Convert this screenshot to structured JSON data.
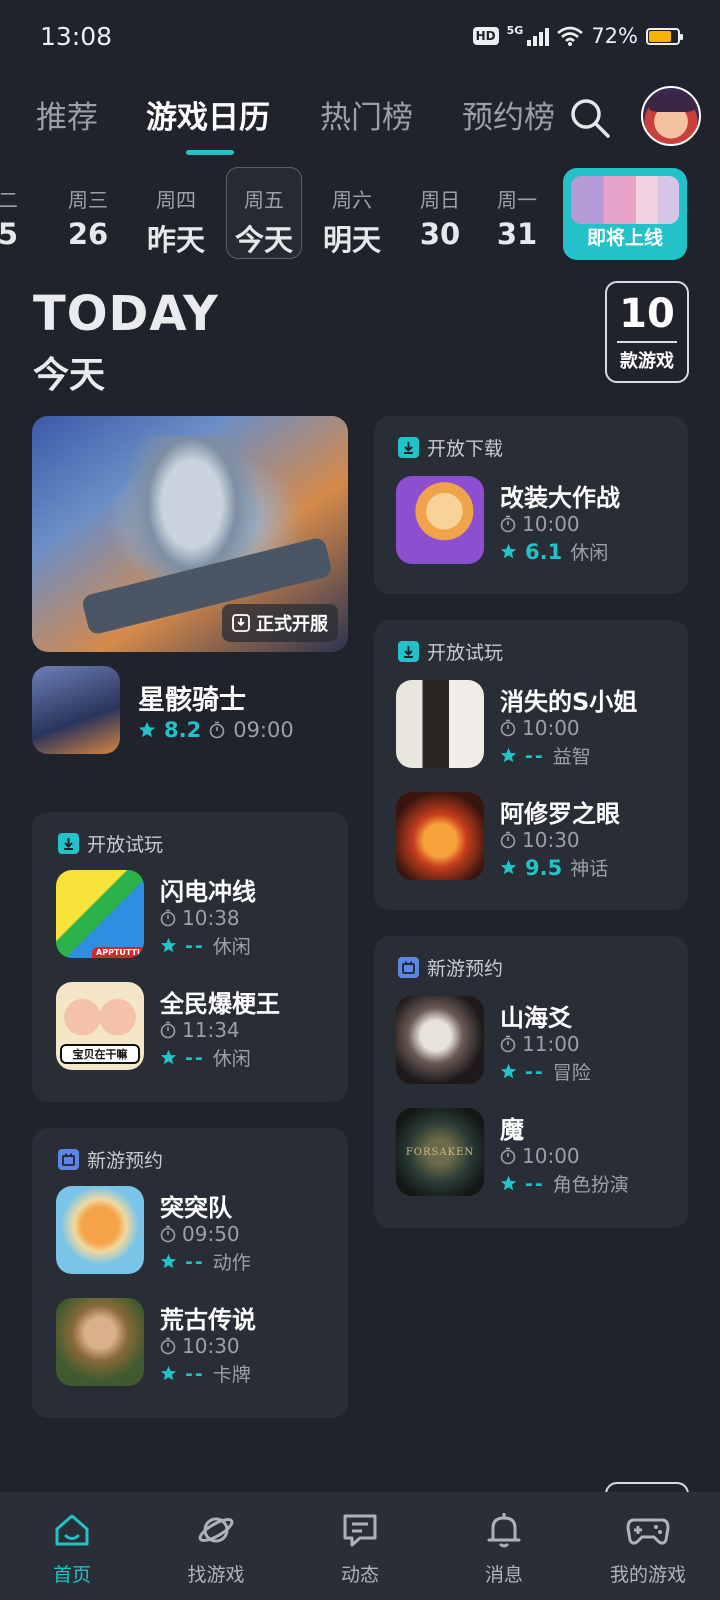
{
  "status": {
    "time": "13:08",
    "hd": "HD",
    "network": "5G",
    "battery": "72%",
    "battery_level": 0.72
  },
  "top_tabs": [
    {
      "label": "推荐"
    },
    {
      "label": "游戏日历"
    },
    {
      "label": "热门榜"
    },
    {
      "label": "预约榜"
    }
  ],
  "days": [
    {
      "dow": "二",
      "num": "5"
    },
    {
      "dow": "周三",
      "num": "26"
    },
    {
      "dow": "周四",
      "num": "昨天"
    },
    {
      "dow": "周五",
      "num": "今天"
    },
    {
      "dow": "周六",
      "num": "明天"
    },
    {
      "dow": "周日",
      "num": "30"
    },
    {
      "dow": "周一",
      "num": "31"
    }
  ],
  "upcoming_label": "即将上线",
  "today": {
    "en": "TODAY",
    "cn": "今天",
    "count": "10",
    "count_unit": "款游戏"
  },
  "featured": {
    "badge": "正式开服",
    "name": "星骸骑士",
    "score": "8.2",
    "time": "09:00"
  },
  "cards": {
    "download": {
      "title": "开放下载",
      "games": [
        {
          "name": "改装大作战",
          "time": "10:00",
          "score": "6.1",
          "genre": "休闲"
        }
      ]
    },
    "trial_right": {
      "title": "开放试玩",
      "games": [
        {
          "name": "消失的S小姐",
          "time": "10:00",
          "score": "--",
          "genre": "益智"
        },
        {
          "name": "阿修罗之眼",
          "time": "10:30",
          "score": "9.5",
          "genre": "神话"
        }
      ]
    },
    "preorder_right": {
      "title": "新游预约",
      "games": [
        {
          "name": "山海爻",
          "time": "11:00",
          "score": "--",
          "genre": "冒险"
        },
        {
          "name": "魔",
          "time": "10:00",
          "score": "--",
          "genre": "角色扮演"
        }
      ]
    },
    "trial_left": {
      "title": "开放试玩",
      "games": [
        {
          "name": "闪电冲线",
          "time": "10:38",
          "score": "--",
          "genre": "休闲"
        },
        {
          "name": "全民爆梗王",
          "time": "11:34",
          "score": "--",
          "genre": "休闲"
        }
      ]
    },
    "preorder_left": {
      "title": "新游预约",
      "games": [
        {
          "name": "突突队",
          "time": "09:50",
          "score": "--",
          "genre": "动作"
        },
        {
          "name": "荒古传说",
          "time": "10:30",
          "score": "--",
          "genre": "卡牌"
        }
      ]
    }
  },
  "icon_text": {
    "apptutti": "APPTUTTI",
    "meme": "宝贝在干嘛",
    "forsaken": "FORSAKEN"
  },
  "nav": [
    {
      "label": "首页",
      "icon": "home-icon"
    },
    {
      "label": "找游戏",
      "icon": "planet-icon"
    },
    {
      "label": "动态",
      "icon": "chat-icon"
    },
    {
      "label": "消息",
      "icon": "bell-icon"
    },
    {
      "label": "我的游戏",
      "icon": "gamepad-icon"
    }
  ],
  "colors": {
    "accent": "#22c2c8",
    "background": "#20232b",
    "card": "#292d36",
    "preorder": "#5b86e5"
  }
}
